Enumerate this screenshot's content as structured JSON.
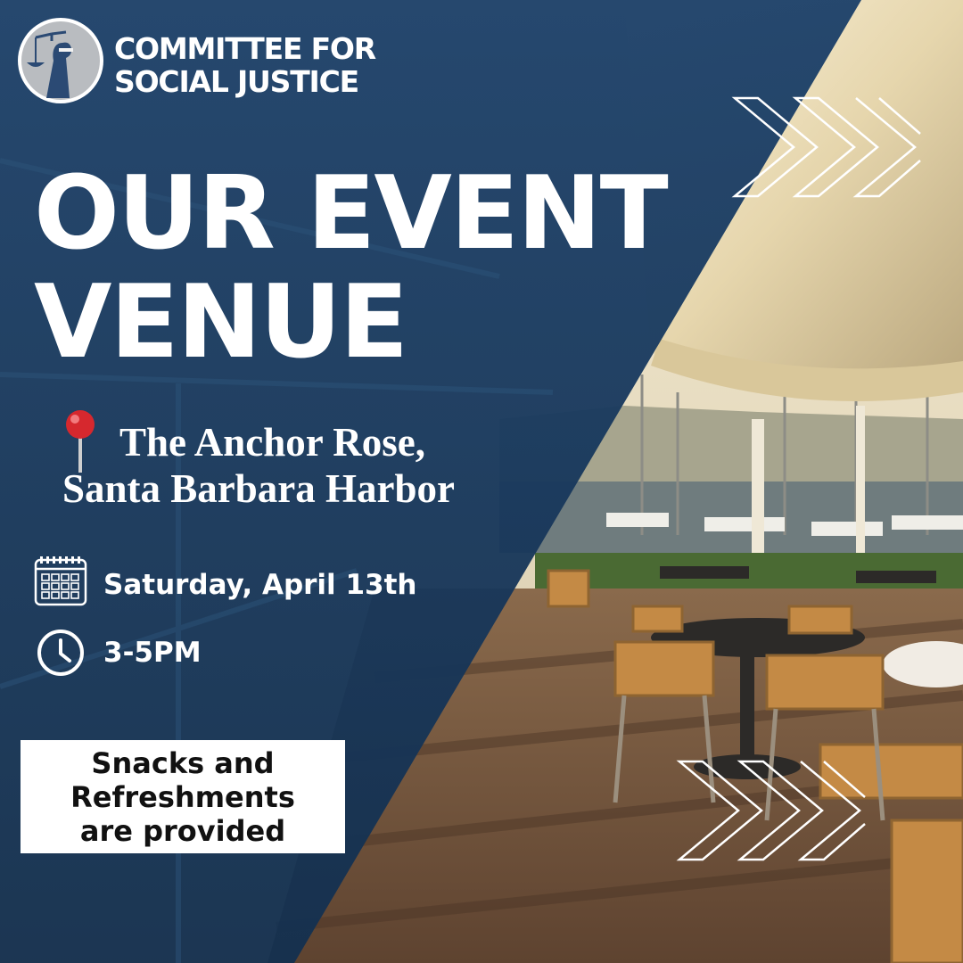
{
  "organization": {
    "name_line1": "COMMITTEE FOR",
    "name_line2": "SOCIAL JUSTICE",
    "logo_icon": "lady-justice-icon"
  },
  "headline": {
    "line1": "OUR EVENT",
    "line2": "VENUE"
  },
  "venue": {
    "icon": "map-pin-icon",
    "line1": "The Anchor Rose,",
    "line2": "Santa Barbara Harbor"
  },
  "date": {
    "icon": "calendar-icon",
    "text": "Saturday, April 13th"
  },
  "time": {
    "icon": "clock-icon",
    "text": "3-5PM"
  },
  "note": {
    "line1": "Snacks and",
    "line2": "Refreshments",
    "line3": "are provided"
  },
  "decorations": {
    "chevrons": "triple-chevron-icon"
  },
  "colors": {
    "panel": "#1b3c61",
    "text": "#ffffff",
    "note_background": "#ffffff",
    "note_text": "#111111",
    "pin": "#d6282e"
  }
}
